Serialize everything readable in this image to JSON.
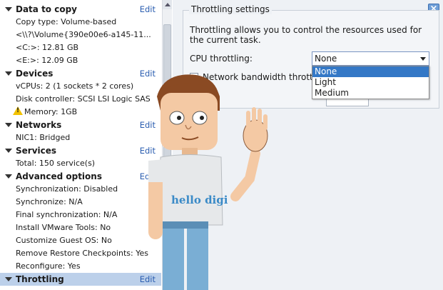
{
  "summary": {
    "sections": [
      {
        "title": "Data to copy",
        "edit": "Edit",
        "rows": [
          "Copy type: Volume-based",
          "<\\\\?\\Volume{390e00e6-a145-11...",
          "<C:>: 12.81 GB",
          "<E:>: 12.09 GB"
        ]
      },
      {
        "title": "Devices",
        "edit": "Edit",
        "rows": [
          "vCPUs: 2 (1 sockets * 2 cores)",
          "Disk controller: SCSI LSI Logic SAS",
          "Memory: 1GB"
        ]
      },
      {
        "title": "Networks",
        "edit": "Edit",
        "rows": [
          "NIC1: Bridged"
        ]
      },
      {
        "title": "Services",
        "edit": "Edit",
        "rows": [
          "Total: 150 service(s)"
        ]
      },
      {
        "title": "Advanced options",
        "edit": "Edit",
        "rows": [
          "Synchronization: Disabled",
          "Synchronize: N/A",
          "Final synchronization: N/A",
          "Install VMware Tools: No",
          "Customize Guest OS: No",
          "Remove Restore Checkpoints: Yes",
          "Reconfigure: Yes"
        ]
      },
      {
        "title": "Throttling",
        "edit": "Edit",
        "rows": []
      }
    ]
  },
  "throttling": {
    "title": "Throttling settings",
    "close": "×",
    "description": "Throttling allows you to control the resources used for the current task.",
    "cpu_label": "CPU throttling:",
    "cpu_value": "None",
    "options": [
      "None",
      "Light",
      "Medium"
    ],
    "network_label": "Network bandwidth throttling"
  },
  "mascot": {
    "shirt_text": "hello digi"
  },
  "colors": {
    "accent": "#3478c6",
    "edit_link": "#2a5db0",
    "selected_section": "#bcd0ea"
  }
}
